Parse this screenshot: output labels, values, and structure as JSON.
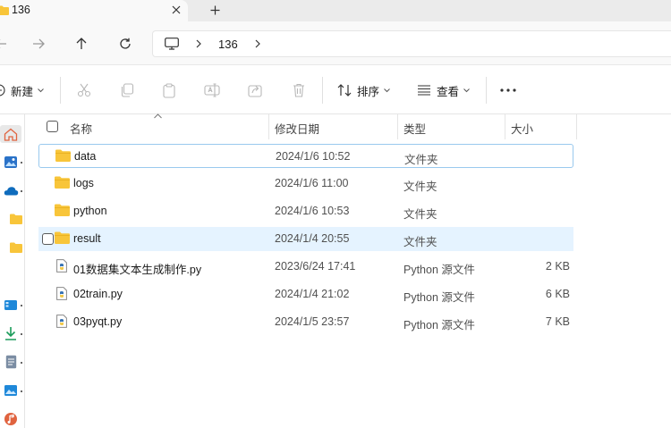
{
  "tab": {
    "title": "136",
    "close_icon": "close-icon",
    "new_tab_icon": "plus-icon"
  },
  "nav": {
    "back_icon": "arrow-left-icon",
    "forward_icon": "arrow-right-icon",
    "up_icon": "arrow-up-icon",
    "refresh_icon": "refresh-icon",
    "breadcrumb": [
      "136"
    ]
  },
  "toolbar": {
    "new_label": "新建",
    "sort_label": "排序",
    "view_label": "查看"
  },
  "columns": {
    "name": "名称",
    "date": "修改日期",
    "type": "类型",
    "size": "大小"
  },
  "files": [
    {
      "name": "data",
      "date": "2024/1/6 10:52",
      "type": "文件夹",
      "size": "",
      "kind": "folder",
      "state": "focused"
    },
    {
      "name": "logs",
      "date": "2024/1/6 11:00",
      "type": "文件夹",
      "size": "",
      "kind": "folder",
      "state": ""
    },
    {
      "name": "python",
      "date": "2024/1/6 10:53",
      "type": "文件夹",
      "size": "",
      "kind": "folder",
      "state": ""
    },
    {
      "name": "result",
      "date": "2024/1/4 20:55",
      "type": "文件夹",
      "size": "",
      "kind": "folder",
      "state": "hover"
    },
    {
      "name": "01数据集文本生成制作.py",
      "date": "2023/6/24 17:41",
      "type": "Python 源文件",
      "size": "2 KB",
      "kind": "python",
      "state": ""
    },
    {
      "name": "02train.py",
      "date": "2024/1/4 21:02",
      "type": "Python 源文件",
      "size": "6 KB",
      "kind": "python",
      "state": ""
    },
    {
      "name": "03pyqt.py",
      "date": "2024/1/5 23:57",
      "type": "Python 源文件",
      "size": "7 KB",
      "kind": "python",
      "state": ""
    }
  ],
  "colors": {
    "folder": "#f8c53a",
    "accent": "#0067c0",
    "selection": "#e5f3ff",
    "focus_border": "#99c9ee"
  }
}
